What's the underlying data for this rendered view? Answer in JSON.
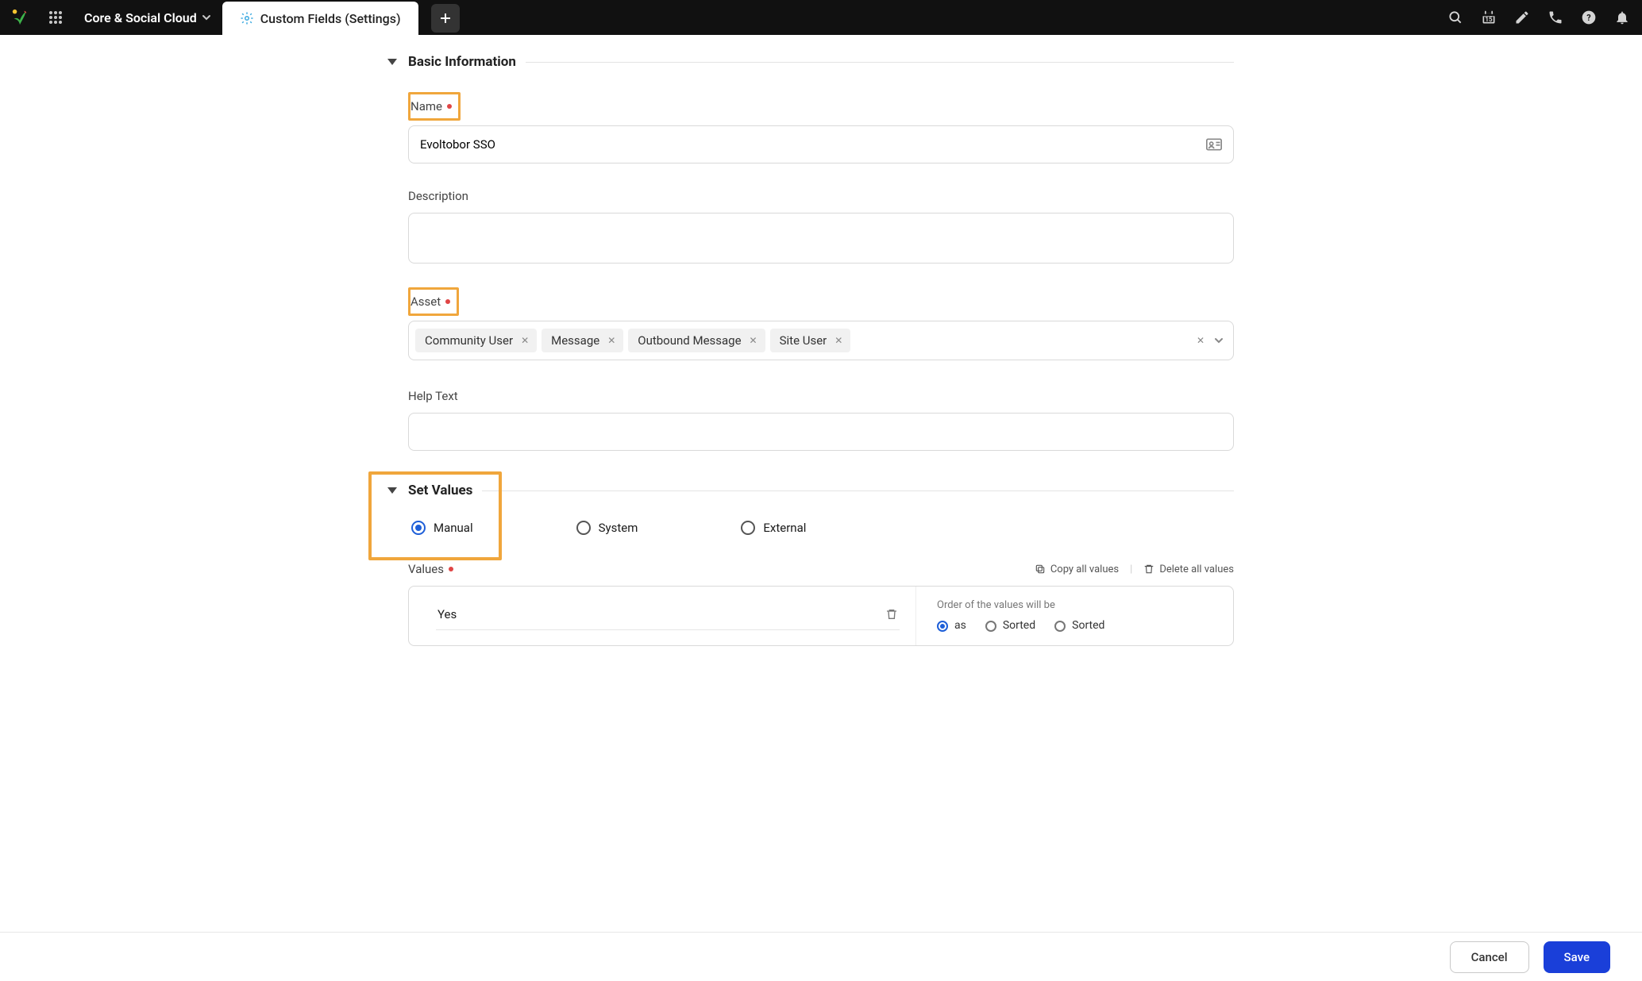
{
  "nav": {
    "workspace": "Core & Social Cloud",
    "tab_label": "Custom Fields (Settings)",
    "calendar_day": "15"
  },
  "sections": {
    "basic_info": {
      "title": "Basic Information",
      "name_label": "Name",
      "name_value": "Evoltobor SSO",
      "description_label": "Description",
      "description_value": "",
      "asset_label": "Asset",
      "help_text_label": "Help Text",
      "help_text_value": ""
    },
    "set_values": {
      "title": "Set Values",
      "options": [
        {
          "label": "Manual",
          "selected": true
        },
        {
          "label": "System",
          "selected": false
        },
        {
          "label": "External",
          "selected": false
        }
      ],
      "values_label": "Values",
      "copy_all": "Copy all values",
      "delete_all": "Delete all values",
      "value_rows": [
        "Yes"
      ],
      "order_hint": "Order of the values will be",
      "sort_options": [
        {
          "label": "as",
          "selected": true
        },
        {
          "label": "Sorted",
          "selected": false
        },
        {
          "label": "Sorted",
          "selected": false
        }
      ]
    }
  },
  "asset_chips": [
    "Community User",
    "Message",
    "Outbound Message",
    "Site User"
  ],
  "footer": {
    "cancel": "Cancel",
    "save": "Save"
  }
}
